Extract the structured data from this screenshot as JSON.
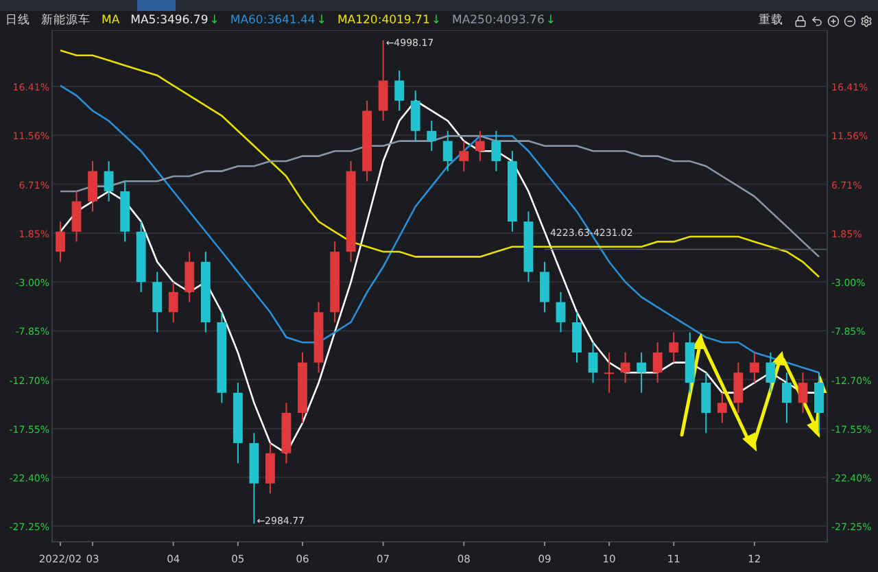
{
  "header": {
    "period": "日线",
    "symbol": "新能源车",
    "ma_label": "MA",
    "reload": "重载",
    "trend_arrows": [
      "↓",
      "↓",
      "↓",
      "↓"
    ]
  },
  "chart_data": {
    "type": "candlestick",
    "ylim": [
      -28.8,
      22
    ],
    "grid": true,
    "categories": [
      "2022/02",
      null,
      "03",
      null,
      null,
      null,
      null,
      "04",
      null,
      null,
      null,
      "05",
      null,
      null,
      null,
      "06",
      null,
      null,
      null,
      null,
      "07",
      null,
      null,
      null,
      null,
      "08",
      null,
      null,
      null,
      null,
      "09",
      null,
      null,
      null,
      "10",
      null,
      null,
      null,
      "11",
      null,
      null,
      null,
      null,
      "12",
      null,
      null,
      null,
      null
    ],
    "ohlc": [
      [
        0,
        3,
        -1,
        2
      ],
      [
        2,
        6,
        1,
        5
      ],
      [
        5,
        9,
        4,
        8
      ],
      [
        8,
        9,
        5,
        6
      ],
      [
        6,
        7,
        1,
        2
      ],
      [
        2,
        3,
        -4,
        -3
      ],
      [
        -3,
        -2,
        -8,
        -6
      ],
      [
        -6,
        -3,
        -7,
        -4
      ],
      [
        -4,
        0,
        -5,
        -1
      ],
      [
        -1,
        0,
        -8,
        -7
      ],
      [
        -7,
        -6,
        -15,
        -14
      ],
      [
        -14,
        -13,
        -21,
        -19
      ],
      [
        -19,
        -18,
        -27,
        -23
      ],
      [
        -23,
        -19,
        -24,
        -20
      ],
      [
        -20,
        -15,
        -21,
        -16
      ],
      [
        -16,
        -10,
        -17,
        -11
      ],
      [
        -11,
        -5,
        -12,
        -6
      ],
      [
        -6,
        1,
        -7,
        0
      ],
      [
        0,
        9,
        -1,
        8
      ],
      [
        8,
        15,
        7,
        14
      ],
      [
        14,
        21,
        13,
        17
      ],
      [
        17,
        18,
        14,
        15
      ],
      [
        15,
        16,
        11,
        12
      ],
      [
        12,
        13,
        10,
        11
      ],
      [
        11,
        12,
        8,
        9
      ],
      [
        9,
        11,
        8,
        10
      ],
      [
        10,
        12,
        9,
        11
      ],
      [
        11,
        12,
        8,
        9
      ],
      [
        9,
        10,
        2,
        3
      ],
      [
        3,
        4,
        -3,
        -2
      ],
      [
        -2,
        -1,
        -6,
        -5
      ],
      [
        -5,
        -4,
        -8,
        -7
      ],
      [
        -7,
        -6,
        -11,
        -10
      ],
      [
        -10,
        -9,
        -13,
        -12
      ],
      [
        -12,
        -10,
        -14,
        -12
      ],
      [
        -12,
        -10,
        -13,
        -11
      ],
      [
        -11,
        -10,
        -14,
        -12
      ],
      [
        -12,
        -9,
        -13,
        -10
      ],
      [
        -10,
        -8,
        -11,
        -9
      ],
      [
        -9,
        -8,
        -14,
        -13
      ],
      [
        -13,
        -12,
        -18,
        -16
      ],
      [
        -16,
        -14,
        -17,
        -15
      ],
      [
        -15,
        -11,
        -16,
        -12
      ],
      [
        -12,
        -10,
        -13,
        -11
      ],
      [
        -11,
        -10,
        -14,
        -13
      ],
      [
        -13,
        -12,
        -17,
        -15
      ],
      [
        -15,
        -12,
        -16,
        -13
      ],
      [
        -13,
        -12,
        -18,
        -16
      ]
    ],
    "yticks": [
      {
        "value": 16.41,
        "label": "16.41%"
      },
      {
        "value": 11.56,
        "label": "11.56%"
      },
      {
        "value": 6.71,
        "label": "6.71%"
      },
      {
        "value": 1.85,
        "label": "1.85%"
      },
      {
        "value": -3,
        "label": "-3.00%"
      },
      {
        "value": -7.85,
        "label": "-7.85%"
      },
      {
        "value": -12.7,
        "label": "-12.70%"
      },
      {
        "value": -17.55,
        "label": "-17.55%"
      },
      {
        "value": -22.4,
        "label": "-22.40%"
      },
      {
        "value": -27.25,
        "label": "-27.25%"
      }
    ],
    "series": [
      {
        "name": "MA5:3496.79",
        "type": "line",
        "color": "#ffffff",
        "values": [
          2,
          4,
          5,
          6,
          5,
          3,
          -1,
          -3,
          -4,
          -3,
          -6,
          -10,
          -15,
          -19,
          -20,
          -17,
          -13,
          -8,
          -3,
          3,
          9,
          13,
          15,
          14,
          13,
          11,
          10,
          10,
          9,
          6,
          2,
          -2,
          -6,
          -9,
          -11,
          -12,
          -12,
          -12,
          -11,
          -11,
          -12,
          -14,
          -14,
          -13,
          -12,
          -13,
          -14,
          -14
        ]
      },
      {
        "name": "MA60:3641.44",
        "type": "line",
        "color": "#2a8fd8",
        "values": [
          16.5,
          15.5,
          14,
          13,
          11.5,
          10,
          8,
          6,
          4,
          2,
          0,
          -2,
          -4,
          -6,
          -8.5,
          -9,
          -9,
          -8,
          -7,
          -4,
          -1.5,
          1.5,
          4.5,
          6.5,
          8.5,
          10,
          11.5,
          11.5,
          11.5,
          10,
          8,
          6,
          4,
          1.5,
          -1,
          -3,
          -4.5,
          -5.5,
          -6.5,
          -7.5,
          -8.5,
          -9,
          -9,
          -10,
          -10.5,
          -11,
          -11.5,
          -12
        ]
      },
      {
        "name": "MA120:4019.71",
        "type": "line",
        "color": "#e8e000",
        "values": [
          20,
          19.5,
          19.5,
          19,
          18.5,
          18,
          17.5,
          16.5,
          15.5,
          14.5,
          13.5,
          12,
          10.5,
          9,
          7.5,
          5,
          3,
          2,
          1,
          0.5,
          0,
          0,
          -0.5,
          -0.5,
          -0.5,
          -0.5,
          -0.5,
          0,
          0.5,
          0.5,
          0.5,
          0.5,
          0.5,
          0.5,
          0.5,
          0.5,
          0.5,
          1,
          1,
          1.5,
          1.5,
          1.5,
          1.5,
          1,
          0.5,
          0,
          -1,
          -2.5
        ]
      },
      {
        "name": "MA250:4093.76",
        "type": "line",
        "color": "#8a95a5",
        "values": [
          6,
          6,
          6.5,
          6.5,
          7,
          7,
          7,
          7.5,
          7.5,
          8,
          8,
          8.5,
          8.5,
          9,
          9,
          9.5,
          9.5,
          10,
          10,
          10.5,
          10.5,
          11,
          11,
          11,
          11.5,
          11.5,
          11.5,
          11,
          11,
          11,
          10.5,
          10.5,
          10.5,
          10,
          10,
          10,
          9.5,
          9.5,
          9,
          9,
          8.5,
          7.5,
          6.5,
          5.5,
          4,
          2.5,
          1,
          -0.5
        ]
      }
    ],
    "annotations": [
      "←4998.17",
      "←2984.77",
      "4223.63-4231.02"
    ]
  }
}
